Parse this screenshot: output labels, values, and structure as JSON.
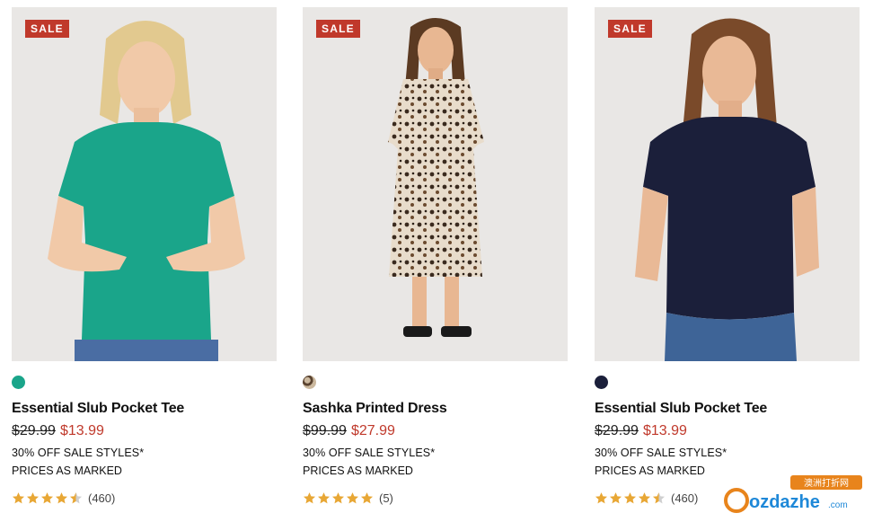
{
  "products": [
    {
      "badge": "SALE",
      "swatch_color": "#1aa58a",
      "image_icon": "model-green-tee-image",
      "title": "Essential Slub Pocket Tee",
      "was_price": "$29.99",
      "now_price": "$13.99",
      "promo": "30% OFF SALE STYLES*",
      "promo2": "PRICES AS MARKED",
      "rating": 4.5,
      "reviews": "(460)"
    },
    {
      "badge": "SALE",
      "swatch_color": "#8a7a6a",
      "image_icon": "model-leopard-dress-image",
      "title": "Sashka Printed Dress",
      "was_price": "$99.99",
      "now_price": "$27.99",
      "promo": "30% OFF SALE STYLES*",
      "promo2": "PRICES AS MARKED",
      "rating": 5,
      "reviews": "(5)"
    },
    {
      "badge": "SALE",
      "swatch_color": "#1b1f3a",
      "image_icon": "model-navy-tee-image",
      "title": "Essential Slub Pocket Tee",
      "was_price": "$29.99",
      "now_price": "$13.99",
      "promo": "30% OFF SALE STYLES*",
      "promo2": "PRICES AS MARKED",
      "rating": 4.5,
      "reviews": "(460)"
    }
  ],
  "colors": {
    "sale_red": "#c0392b",
    "star": "#e8a735"
  },
  "watermark": {
    "text": "ozdazhe",
    "suffix": ".com",
    "tag": "澳洲打折网"
  }
}
